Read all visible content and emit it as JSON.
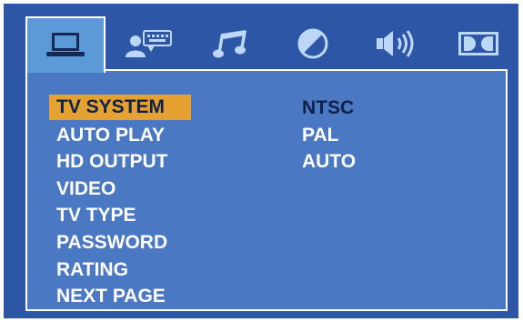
{
  "colors": {
    "frame": "#2d57a6",
    "panel": "#4a78c2",
    "active_tab": "#5b9ad6",
    "highlight": "#e6a230",
    "highlight_text": "#10214a",
    "text": "#ffffff",
    "icon": "#bcd8f6"
  },
  "tabs": [
    {
      "icon": "laptop-icon",
      "active": true
    },
    {
      "icon": "user-keyboard-icon",
      "active": false
    },
    {
      "icon": "music-note-icon",
      "active": false
    },
    {
      "icon": "contrast-icon",
      "active": false
    },
    {
      "icon": "speaker-icon",
      "active": false
    },
    {
      "icon": "dolby-icon",
      "active": false
    }
  ],
  "menu": {
    "selected_index": 0,
    "items": [
      {
        "label": "TV SYSTEM"
      },
      {
        "label": "AUTO PLAY"
      },
      {
        "label": "HD OUTPUT"
      },
      {
        "label": "VIDEO"
      },
      {
        "label": "TV TYPE"
      },
      {
        "label": "PASSWORD"
      },
      {
        "label": "RATING"
      },
      {
        "label": "NEXT PAGE"
      }
    ]
  },
  "options": {
    "current_index": 0,
    "items": [
      {
        "label": "NTSC"
      },
      {
        "label": "PAL"
      },
      {
        "label": "AUTO"
      }
    ]
  }
}
